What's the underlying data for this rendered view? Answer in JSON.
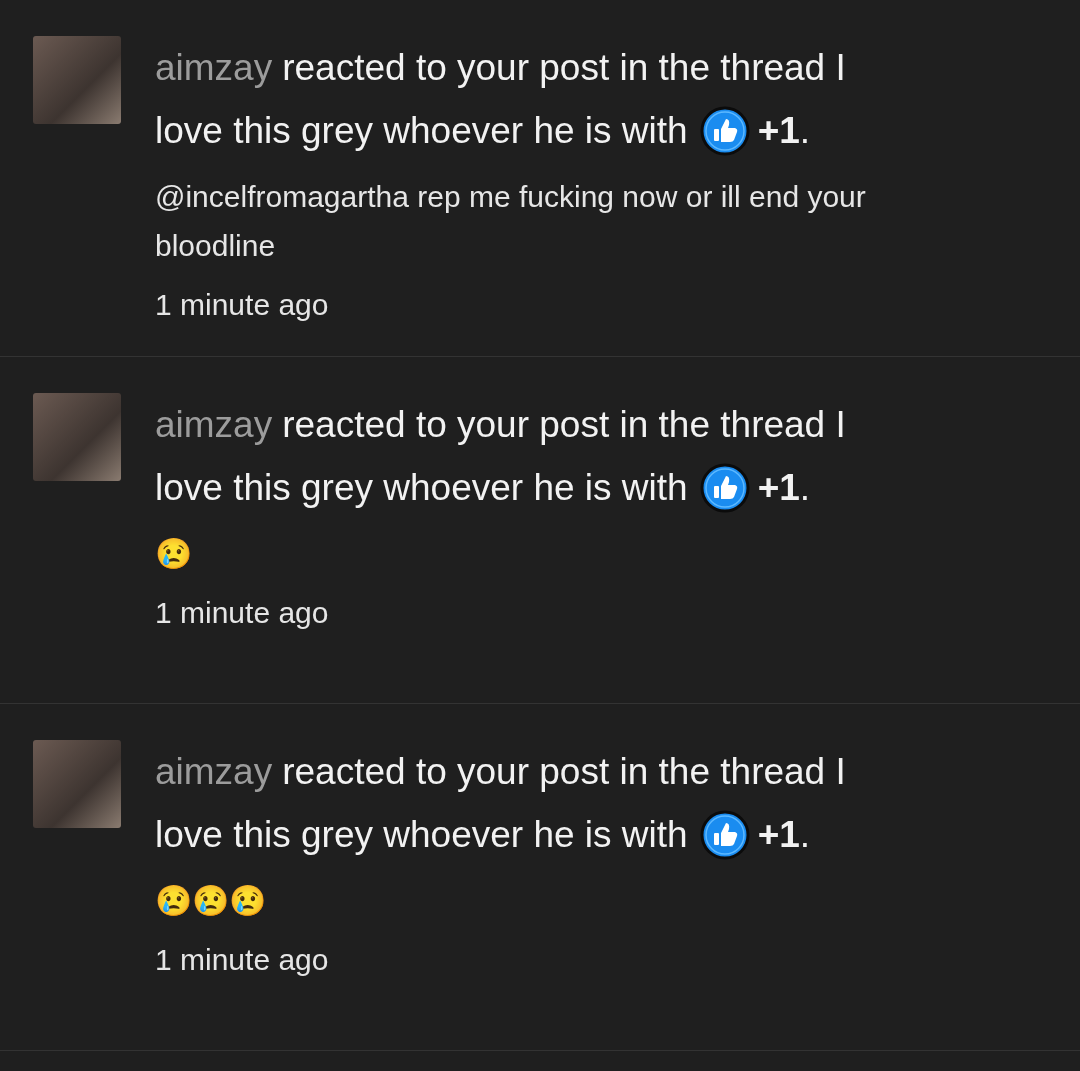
{
  "notifications": [
    {
      "username": "aimzay",
      "text": [
        "reacted to your post in the thread I",
        "love this grey whoever he is with"
      ],
      "reaction": "**+1**.",
      "message": "@incelfromagartha rep me fucking now or ill end your bloodline",
      "time": "1 minute ago"
    },
    {
      "username": "aimzay",
      "text": [
        "reacted to your post in the thread I",
        "love this grey whoever he is with"
      ],
      "reaction": "**+1**.",
      "message": "😢",
      "time": "1 minute ago"
    },
    {
      "username": "aimzay",
      "text": [
        "reacted to your post in the thread I",
        "love this grey whoever he is with"
      ],
      "reaction": "**+1**.",
      "message": "😢😢😢",
      "time": "1 minute ago"
    }
  ]
}
